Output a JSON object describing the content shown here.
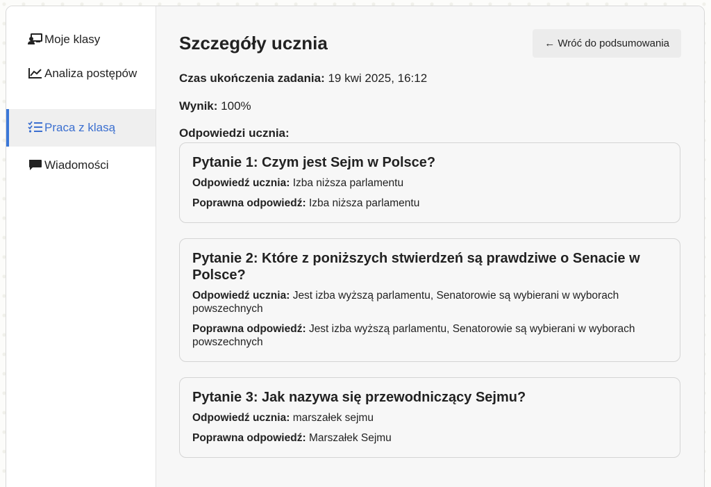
{
  "sidebar": {
    "items": [
      {
        "label": "Moje klasy",
        "icon": "teacher-board-icon",
        "active": false
      },
      {
        "label": "Analiza postępów",
        "icon": "line-chart-icon",
        "active": false
      },
      {
        "label": "Praca z klasą",
        "icon": "checklist-icon",
        "active": true
      },
      {
        "label": "Wiadomości",
        "icon": "chat-bubble-icon",
        "active": false
      }
    ]
  },
  "main": {
    "title": "Szczegóły ucznia",
    "back_button": "← Wróć do podsumowania",
    "completion_label": "Czas ukończenia zadania:",
    "completion_value": "19 kwi 2025, 16:12",
    "score_label": "Wynik:",
    "score_value": "100%",
    "answers_heading": "Odpowiedzi ucznia:",
    "student_answer_label": "Odpowiedź ucznia:",
    "correct_answer_label": "Poprawna odpowiedź:",
    "questions": [
      {
        "title": "Pytanie 1: Czym jest Sejm w Polsce?",
        "student_answer": "Izba niższa parlamentu",
        "correct_answer": "Izba niższa parlamentu"
      },
      {
        "title": "Pytanie 2: Które z poniższych stwierdzeń są prawdziwe o Senacie w Polsce?",
        "student_answer": "Jest izba wyższą parlamentu, Senatorowie są wybierani w wyborach powszechnych",
        "correct_answer": "Jest izba wyższą parlamentu, Senatorowie są wybierani w wyborach powszechnych"
      },
      {
        "title": "Pytanie 3: Jak nazywa się przewodniczący Sejmu?",
        "student_answer": "marszałek sejmu",
        "correct_answer": "Marszałek Sejmu"
      }
    ]
  },
  "colors": {
    "accent": "#3b6fd0",
    "active_bg": "#efefef",
    "main_bg": "#f7f7f7"
  }
}
